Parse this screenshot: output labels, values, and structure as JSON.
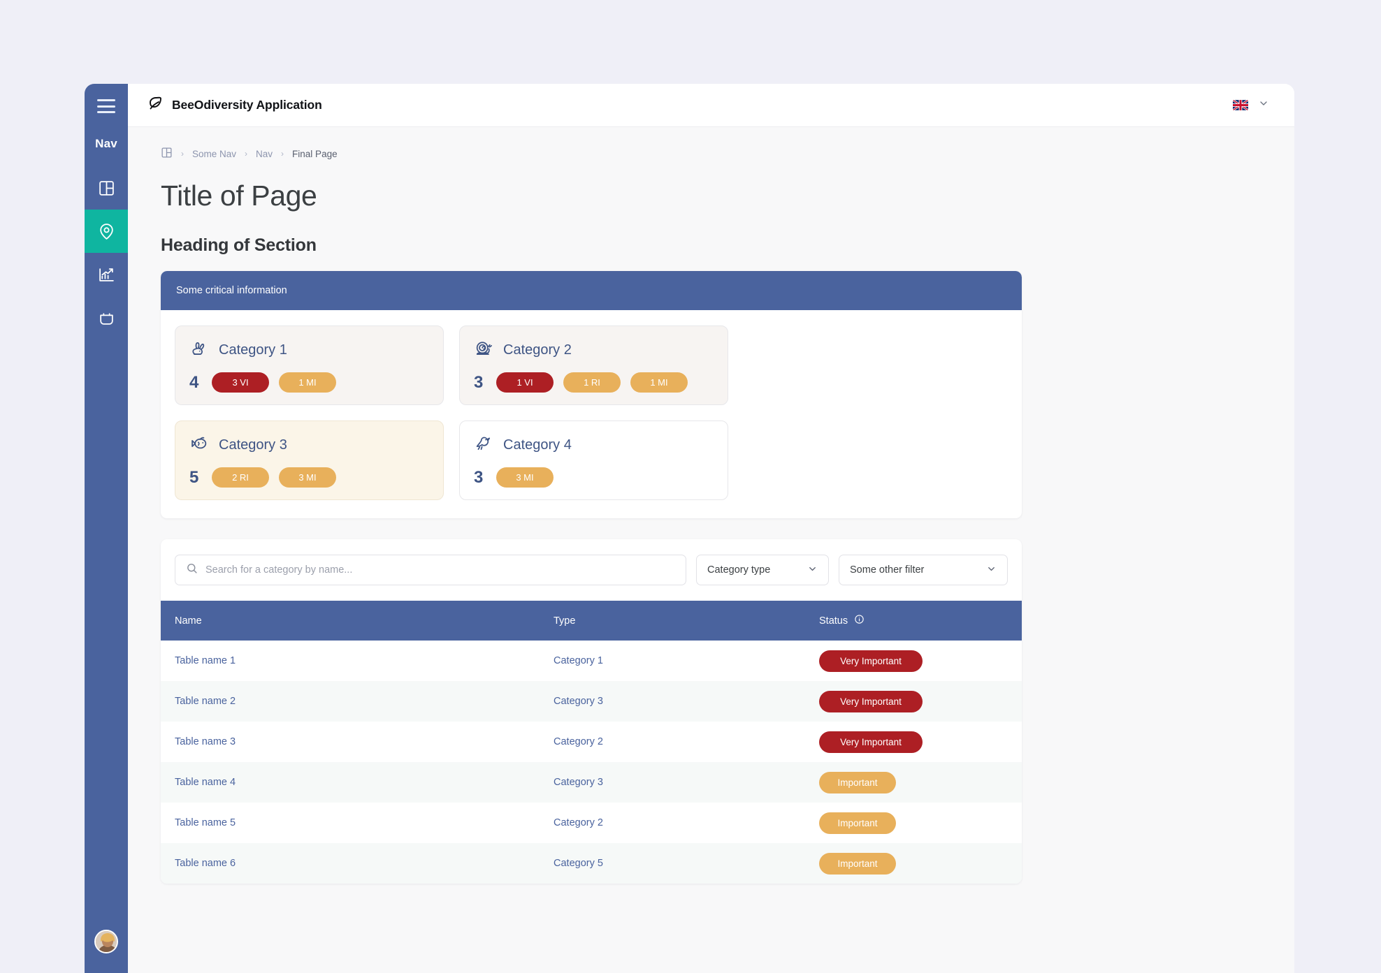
{
  "sidebar": {
    "menu_icon": "hamburger-icon",
    "nav_label": "Nav",
    "items": [
      {
        "icon": "layout-panel-icon",
        "active": false
      },
      {
        "icon": "map-pin-icon",
        "active": true
      },
      {
        "icon": "trending-up-chart-icon",
        "active": false
      },
      {
        "icon": "basket-icon",
        "active": false
      }
    ],
    "avatar": "user-avatar",
    "bg_color": "#4A639E",
    "active_color": "#0FB5A0"
  },
  "topbar": {
    "logo_icon": "leaf-icon",
    "app_title": "BeeOdiversity Application",
    "language_flag": "uk-flag-icon",
    "chevron": "chevron-down-icon"
  },
  "breadcrumb": {
    "icon": "panel-layout-icon",
    "items": [
      "Some Nav",
      "Nav",
      "Final Page"
    ],
    "separator": "›"
  },
  "page": {
    "title": "Title of Page",
    "section_heading": "Heading of Section"
  },
  "panel": {
    "banner_text": "Some critical information",
    "banner_color": "#4A639E",
    "cards": [
      {
        "icon": "rabbit-icon",
        "name": "Category 1",
        "count": "4",
        "tint": "tint-warm",
        "pills": [
          {
            "label": "3 VI",
            "color": "red"
          },
          {
            "label": "1 MI",
            "color": "amber"
          }
        ]
      },
      {
        "icon": "snail-icon",
        "name": "Category 2",
        "count": "3",
        "tint": "tint-warm",
        "pills": [
          {
            "label": "1 VI",
            "color": "red"
          },
          {
            "label": "1 RI",
            "color": "amber"
          },
          {
            "label": "1 MI",
            "color": "amber"
          }
        ]
      },
      {
        "icon": "fish-icon",
        "name": "Category 3",
        "count": "5",
        "tint": "tint-cream",
        "pills": [
          {
            "label": "2 RI",
            "color": "amber"
          },
          {
            "label": "3 MI",
            "color": "amber"
          }
        ]
      },
      {
        "icon": "bird-icon",
        "name": "Category 4",
        "count": "3",
        "tint": "tint-white",
        "pills": [
          {
            "label": "3 MI",
            "color": "amber"
          }
        ]
      }
    ]
  },
  "filters": {
    "search_icon": "search-icon",
    "search_value": "",
    "search_placeholder": "Search for a category by name...",
    "category_type": {
      "label": "Category type",
      "chevron": "chevron-down-icon"
    },
    "other_filter": {
      "label": "Some other filter",
      "chevron": "chevron-down-icon"
    }
  },
  "table": {
    "columns": [
      "Name",
      "Type",
      "Status"
    ],
    "status_info_icon": "info-icon",
    "rows": [
      {
        "name": "Table name 1",
        "type": "Category 1",
        "status": "Very Important",
        "status_color": "red"
      },
      {
        "name": "Table name 2",
        "type": "Category 3",
        "status": "Very Important",
        "status_color": "red"
      },
      {
        "name": "Table name 3",
        "type": "Category 2",
        "status": "Very Important",
        "status_color": "red"
      },
      {
        "name": "Table name 4",
        "type": "Category 3",
        "status": "Important",
        "status_color": "amber"
      },
      {
        "name": "Table name 5",
        "type": "Category 2",
        "status": "Important",
        "status_color": "amber"
      },
      {
        "name": "Table name 6",
        "type": "Category 5",
        "status": "Important",
        "status_color": "amber"
      }
    ]
  },
  "colors": {
    "brand_blue": "#4A639E",
    "accent_teal": "#0FB5A0",
    "danger_red": "#AD1F24",
    "warning_amber": "#E8B05B",
    "page_bg": "#EFEFF7"
  }
}
